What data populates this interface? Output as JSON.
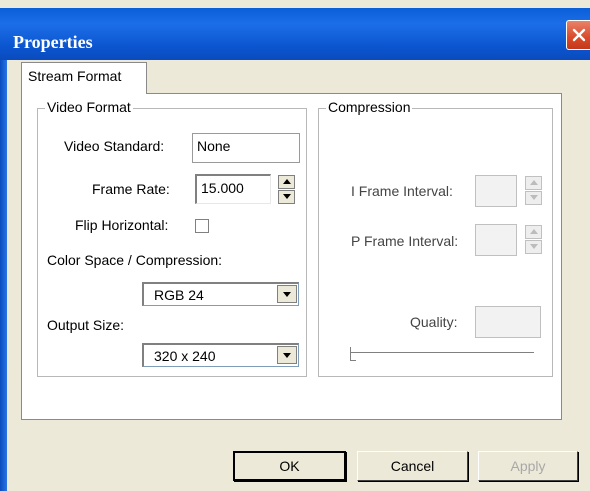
{
  "window": {
    "title": "Properties"
  },
  "tabs": [
    {
      "label": "Stream Format"
    }
  ],
  "video_format": {
    "title": "Video Format",
    "video_standard_label": "Video Standard:",
    "video_standard_value": "None",
    "frame_rate_label": "Frame Rate:",
    "frame_rate_value": "15.000",
    "flip_horizontal_label": "Flip Horizontal:",
    "flip_horizontal_checked": false,
    "color_space_label": "Color Space / Compression:",
    "color_space_value": "RGB 24",
    "output_size_label": "Output Size:",
    "output_size_value": "320 x 240"
  },
  "compression": {
    "title": "Compression",
    "i_frame_label": "I Frame Interval:",
    "i_frame_value": "",
    "p_frame_label": "P Frame Interval:",
    "p_frame_value": "",
    "quality_label": "Quality:",
    "quality_value": "",
    "quality_slider_fraction": 0
  },
  "buttons": {
    "ok": "OK",
    "cancel": "Cancel",
    "apply": "Apply"
  },
  "colors": {
    "titlebar": "#0a5fd8",
    "close": "#d9492a",
    "dialog_bg": "#ece9d8"
  }
}
